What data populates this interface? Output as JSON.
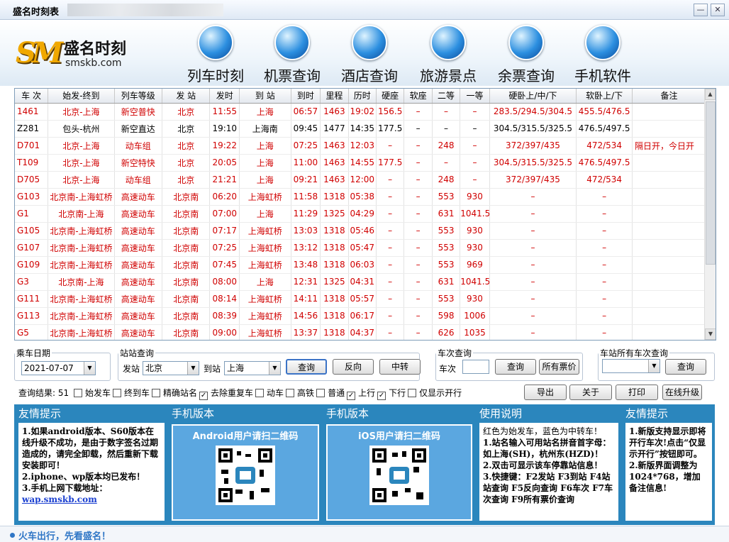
{
  "window": {
    "title": "盛名时刻表",
    "min_label": "—",
    "close_label": "✕"
  },
  "logo": {
    "mark": "SM",
    "cn": "盛名时刻",
    "en": "smskb.com"
  },
  "nav": [
    {
      "label": "列车时刻",
      "icon": "train-icon"
    },
    {
      "label": "机票查询",
      "icon": "plane-icon"
    },
    {
      "label": "酒店查询",
      "icon": "hotel-icon"
    },
    {
      "label": "旅游景点",
      "icon": "globe-icon"
    },
    {
      "label": "余票查询",
      "icon": "windows-icon"
    },
    {
      "label": "手机软件",
      "icon": "java-icon"
    }
  ],
  "table": {
    "headers": [
      "车 次",
      "始发-终到",
      "列车等级",
      "发 站",
      "发时",
      "到 站",
      "到时",
      "里程",
      "历时",
      "硬座",
      "软座",
      "二等",
      "一等",
      "硬卧上/中/下",
      "软卧上/下",
      "备注"
    ],
    "rows": [
      {
        "color": "red",
        "cells": [
          "1461",
          "北京-上海",
          "新空普快",
          "北京",
          "11:55",
          "上海",
          "06:57",
          "1463",
          "19:02",
          "156.5",
          "–",
          "–",
          "–",
          "283.5/294.5/304.5",
          "455.5/476.5",
          ""
        ]
      },
      {
        "color": "black",
        "cells": [
          "Z281",
          "包头-杭州",
          "新空直达",
          "北京",
          "19:10",
          "上海南",
          "09:45",
          "1477",
          "14:35",
          "177.5",
          "–",
          "–",
          "–",
          "304.5/315.5/325.5",
          "476.5/497.5",
          ""
        ]
      },
      {
        "color": "red",
        "cells": [
          "D701",
          "北京-上海",
          "动车组",
          "北京",
          "19:22",
          "上海",
          "07:25",
          "1463",
          "12:03",
          "–",
          "–",
          "248",
          "–",
          "372/397/435",
          "472/534",
          "隔日开，今日开"
        ]
      },
      {
        "color": "red",
        "cells": [
          "T109",
          "北京-上海",
          "新空特快",
          "北京",
          "20:05",
          "上海",
          "11:00",
          "1463",
          "14:55",
          "177.5",
          "–",
          "–",
          "–",
          "304.5/315.5/325.5",
          "476.5/497.5",
          ""
        ]
      },
      {
        "color": "red",
        "cells": [
          "D705",
          "北京-上海",
          "动车组",
          "北京",
          "21:21",
          "上海",
          "09:21",
          "1463",
          "12:00",
          "–",
          "–",
          "248",
          "–",
          "372/397/435",
          "472/534",
          ""
        ]
      },
      {
        "color": "red",
        "cells": [
          "G103",
          "北京南-上海虹桥",
          "高速动车",
          "北京南",
          "06:20",
          "上海虹桥",
          "11:58",
          "1318",
          "05:38",
          "–",
          "–",
          "553",
          "930",
          "–",
          "–",
          ""
        ]
      },
      {
        "color": "red",
        "cells": [
          "G1",
          "北京南-上海",
          "高速动车",
          "北京南",
          "07:00",
          "上海",
          "11:29",
          "1325",
          "04:29",
          "–",
          "–",
          "631",
          "1041.5",
          "–",
          "–",
          ""
        ]
      },
      {
        "color": "red",
        "cells": [
          "G105",
          "北京南-上海虹桥",
          "高速动车",
          "北京南",
          "07:17",
          "上海虹桥",
          "13:03",
          "1318",
          "05:46",
          "–",
          "–",
          "553",
          "930",
          "–",
          "–",
          ""
        ]
      },
      {
        "color": "red",
        "cells": [
          "G107",
          "北京南-上海虹桥",
          "高速动车",
          "北京南",
          "07:25",
          "上海虹桥",
          "13:12",
          "1318",
          "05:47",
          "–",
          "–",
          "553",
          "930",
          "–",
          "–",
          ""
        ]
      },
      {
        "color": "red",
        "cells": [
          "G109",
          "北京南-上海虹桥",
          "高速动车",
          "北京南",
          "07:45",
          "上海虹桥",
          "13:48",
          "1318",
          "06:03",
          "–",
          "–",
          "553",
          "969",
          "–",
          "–",
          ""
        ]
      },
      {
        "color": "red",
        "cells": [
          "G3",
          "北京南-上海",
          "高速动车",
          "北京南",
          "08:00",
          "上海",
          "12:31",
          "1325",
          "04:31",
          "–",
          "–",
          "631",
          "1041.5",
          "–",
          "–",
          ""
        ]
      },
      {
        "color": "red",
        "cells": [
          "G111",
          "北京南-上海虹桥",
          "高速动车",
          "北京南",
          "08:14",
          "上海虹桥",
          "14:11",
          "1318",
          "05:57",
          "–",
          "–",
          "553",
          "930",
          "–",
          "–",
          ""
        ]
      },
      {
        "color": "red",
        "cells": [
          "G113",
          "北京南-上海虹桥",
          "高速动车",
          "北京南",
          "08:39",
          "上海虹桥",
          "14:56",
          "1318",
          "06:17",
          "–",
          "–",
          "598",
          "1006",
          "–",
          "–",
          ""
        ]
      },
      {
        "color": "red",
        "cells": [
          "G5",
          "北京南-上海虹桥",
          "高速动车",
          "北京南",
          "09:00",
          "上海虹桥",
          "13:37",
          "1318",
          "04:37",
          "–",
          "–",
          "626",
          "1035",
          "–",
          "–",
          ""
        ]
      }
    ]
  },
  "controls": {
    "date_legend": "乘车日期",
    "date_value": "2021-07-07",
    "station_legend": "站站查询",
    "from_label": "发站",
    "from_value": "北京",
    "to_label": "到站",
    "to_value": "上海",
    "query": "查询",
    "reverse": "反向",
    "transfer": "中转",
    "train_legend": "车次查询",
    "train_label": "车次",
    "train_query": "查询",
    "all_fares": "所有票价",
    "allstation_legend": "车站所有车次查询",
    "allstation_query": "查询"
  },
  "results": {
    "label": "查询结果: 51"
  },
  "options": [
    {
      "label": "始发车",
      "checked": false
    },
    {
      "label": "终到车",
      "checked": false
    },
    {
      "label": "精确站名",
      "checked": false
    },
    {
      "label": "去除重复车",
      "checked": true
    },
    {
      "label": "动车",
      "checked": false
    },
    {
      "label": "高铁",
      "checked": false
    },
    {
      "label": "普通",
      "checked": false
    },
    {
      "label": "上行",
      "checked": true
    },
    {
      "label": "下行",
      "checked": true
    },
    {
      "label": "仅显示开行",
      "checked": false
    }
  ],
  "actions": {
    "export": "导出",
    "about": "关于",
    "print": "打印",
    "upgrade": "在线升级"
  },
  "panels": {
    "tips1": {
      "title": "友情提示",
      "lines": [
        "1.如果android版本、S60版本在线升级不成功，是由于数字签名过期造成的，请完全卸载，然后重新下载安装即可！",
        "2.iphone、wp版本均已发布！",
        "3.手机上网下载地址：",
        "wap.smskb.com"
      ]
    },
    "mobile1": {
      "title": "手机版本",
      "qr_title": "Android用户请扫二维码"
    },
    "mobile2": {
      "title": "手机版本",
      "qr_title": "iOS用户请扫二维码"
    },
    "usage": {
      "title": "使用说明",
      "lines": [
        "红色为始发车，蓝色为中转车！",
        "1.站名输入可用站名拼音首字母：如上海(SH)，杭州东(HZD)！",
        "2.双击可显示该车停靠站信息！",
        "3.快捷键：F2发站 F3到站 F4站站查询 F5反向查询 F6车次 F7车次查询 F9所有票价查询"
      ]
    },
    "tips2": {
      "title": "友情提示",
      "lines": [
        "1.新版支持显示即将开行车次!点击“仅显示开行”按钮即可。",
        "2.新版界面调整为1024*768，增加备注信息!"
      ]
    }
  },
  "status": {
    "text": "火车出行，先看盛名！"
  },
  "colors": {
    "accent": "#2b86bd",
    "start_train": "#d00000",
    "transfer_train": "#1a3fd0"
  }
}
